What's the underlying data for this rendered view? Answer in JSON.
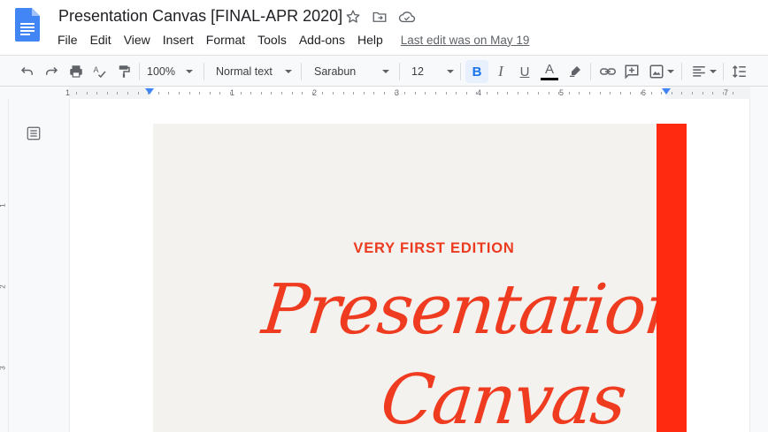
{
  "app": {
    "doc_title": "Presentation Canvas [FINAL-APR 2020]",
    "last_edit": "Last edit was on May 19"
  },
  "menu": [
    "File",
    "Edit",
    "View",
    "Insert",
    "Format",
    "Tools",
    "Add-ons",
    "Help"
  ],
  "toolbar": {
    "zoom": "100%",
    "style": "Normal text",
    "font": "Sarabun",
    "font_size": "12",
    "bold_label": "B",
    "italic_label": "I",
    "underline_label": "U",
    "text_color_label": "A"
  },
  "ruler": {
    "top": [
      "1",
      "1",
      "2",
      "3",
      "4",
      "5",
      "6",
      "7"
    ],
    "side": [
      "1",
      "2",
      "3"
    ]
  },
  "document": {
    "edition": "VERY FIRST EDITION",
    "title_line1": "Presentation",
    "title_line2": "Canvas"
  },
  "colors": {
    "accent": "#ff2a10",
    "title_red": "#ef3b1f",
    "docs_blue": "#4285f4"
  }
}
